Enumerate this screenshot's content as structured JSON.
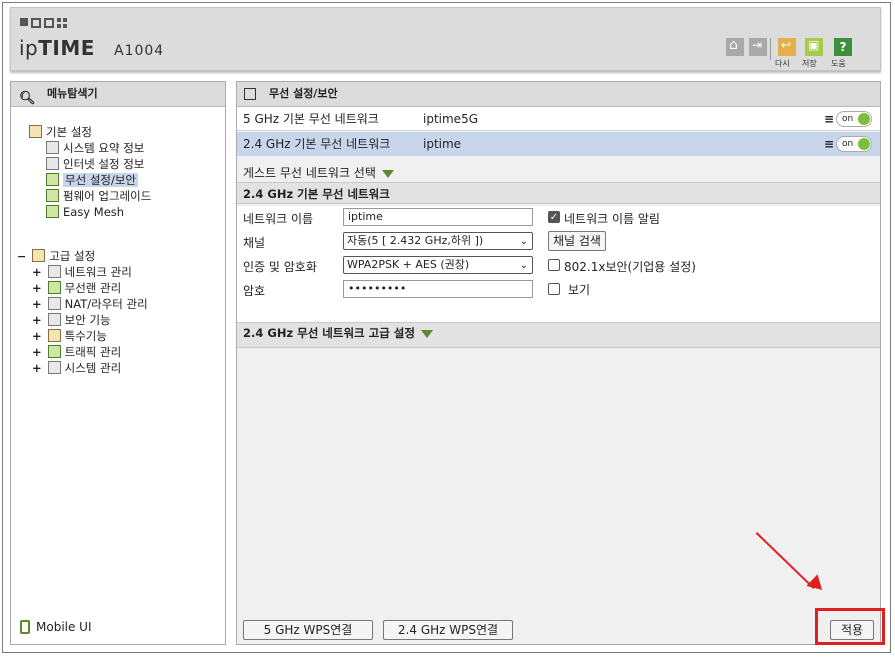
{
  "header": {
    "brand_prefix": "ip",
    "brand_bold": "TIME",
    "model": "A1004",
    "icons": [
      "home-icon",
      "logout-icon",
      "back-icon",
      "save-icon",
      "help-icon"
    ],
    "back_label": "다시",
    "save_label": "저장",
    "help_label": "도움",
    "help_glyph": "?"
  },
  "left_panel": {
    "title": "메뉴탐색기",
    "basic": {
      "label": "기본 설정",
      "items": [
        "시스템 요약 정보",
        "인터넷 설정 정보",
        "무선 설정/보안",
        "펌웨어 업그레이드",
        "Easy Mesh"
      ],
      "selected": "무선 설정/보안"
    },
    "advanced": {
      "toggle": "−",
      "label": "고급 설정",
      "items": [
        "네트워크 관리",
        "무선랜 관리",
        "NAT/라우터 관리",
        "보안 기능",
        "특수기능",
        "트래픽 관리",
        "시스템 관리"
      ],
      "expander": "+"
    },
    "mobile_label": "Mobile UI"
  },
  "right_panel": {
    "title": "무선 설정/보안",
    "networks": [
      {
        "band": "5 GHz 기본 무선 네트워크",
        "ssid": "iptime5G",
        "toggle": "on"
      },
      {
        "band": "2.4 GHz 기본 무선 네트워크",
        "ssid": "iptime",
        "toggle": "on"
      }
    ],
    "guest_label": "게스트 무선 네트워크 선택",
    "section_title": "2.4 GHz 기본 무선 네트워크",
    "form": {
      "name_label": "네트워크 이름",
      "name_value": "iptime",
      "broadcast_label": "네트워크 이름 알림",
      "broadcast_checked": true,
      "channel_label": "채널",
      "channel_value": "자동(5 [ 2.432 GHz,하위 ])",
      "channel_search": "채널 검색",
      "auth_label": "인증 및 암호화",
      "auth_value": "WPA2PSK + AES (권장)",
      "enterprise_label": "802.1x보안(기업용 설정)",
      "enterprise_checked": false,
      "password_label": "암호",
      "password_value": "•••••••••",
      "show_label": "보기",
      "show_checked": false
    },
    "advanced_title": "2.4 GHz 무선 네트워크 고급 설정",
    "wps5_button": "5 GHz WPS연결",
    "wps24_button": "2.4 GHz WPS연결",
    "apply_button": "적용"
  },
  "colors": {
    "selected_row": "#c8d6ec",
    "accent_green": "#7dbf3a",
    "annotation_red": "#e02020"
  }
}
